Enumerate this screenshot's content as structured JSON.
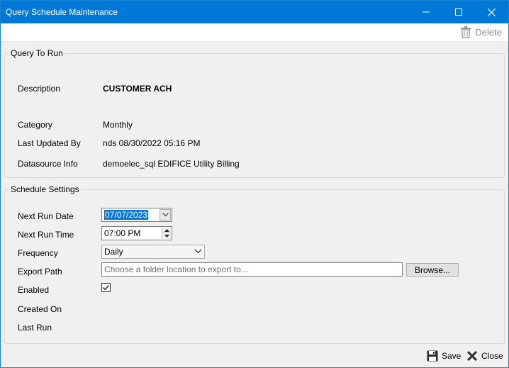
{
  "window": {
    "title": "Query Schedule Maintenance"
  },
  "toolbar": {
    "delete_label": "Delete"
  },
  "query": {
    "legend": "Query To Run",
    "description_label": "Description",
    "description_value": "CUSTOMER ACH",
    "category_label": "Category",
    "category_value": "Monthly",
    "last_updated_label": "Last Updated By",
    "last_updated_value": "nds 08/30/2022 05:16 PM",
    "datasource_label": "Datasource Info",
    "datasource_value": "demoelec_sql EDIFICE Utility Billing"
  },
  "schedule": {
    "legend": "Schedule Settings",
    "next_run_date_label": "Next Run Date",
    "next_run_date_value": "07/07/2023",
    "next_run_time_label": "Next Run Time",
    "next_run_time_value": "07:00 PM",
    "frequency_label": "Frequency",
    "frequency_value": "Daily",
    "export_path_label": "Export Path",
    "export_path_value": "",
    "export_path_placeholder": "Choose a folder location to export to...",
    "browse_label": "Browse...",
    "enabled_label": "Enabled",
    "enabled_checked": true,
    "created_on_label": "Created On",
    "created_on_value": "",
    "last_run_label": "Last Run",
    "last_run_value": ""
  },
  "footer": {
    "save_label": "Save",
    "close_label": "Close"
  },
  "colors": {
    "accent": "#0078d7",
    "background": "#f0f0f0",
    "border": "#d9d9d9"
  },
  "icons": {
    "minimize": "minimize-icon",
    "maximize": "maximize-icon",
    "close": "close-icon",
    "delete": "trash-icon",
    "save": "floppy-disk-icon",
    "close_footer": "x-icon"
  }
}
